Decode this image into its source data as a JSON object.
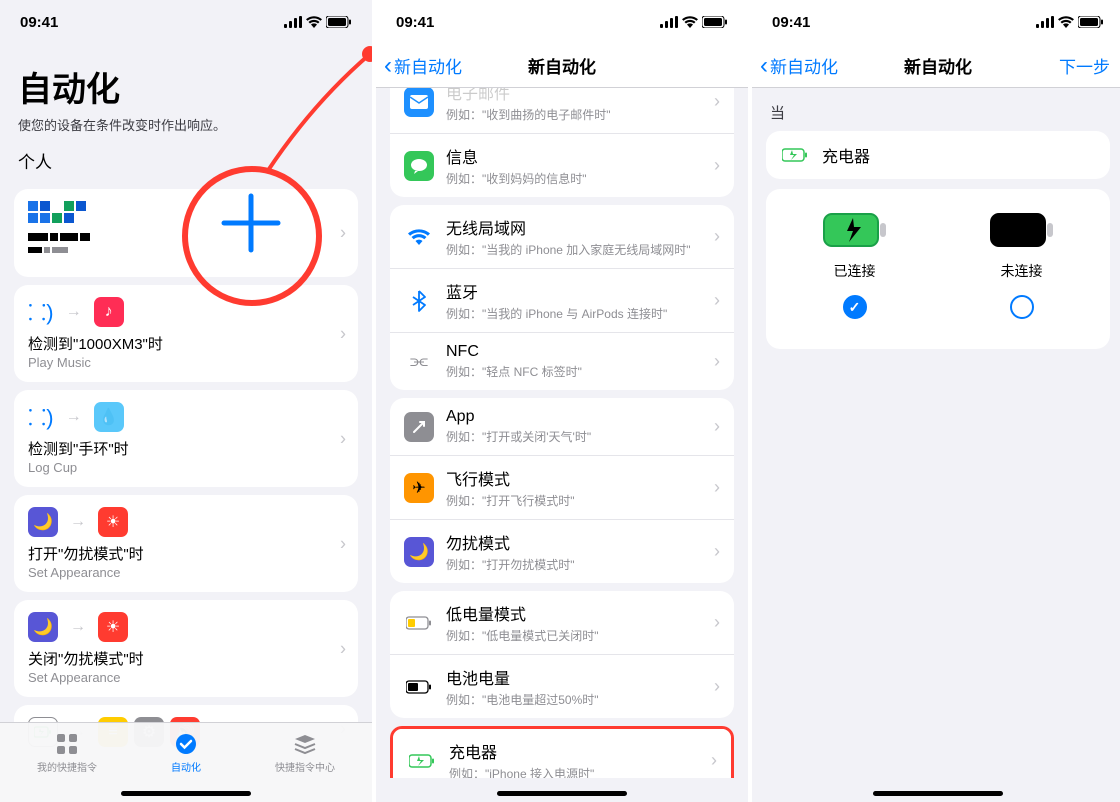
{
  "status": {
    "time": "09:41"
  },
  "screen1": {
    "large_title": "自动化",
    "subtitle": "使您的设备在条件改变时作出响应。",
    "section_personal": "个人",
    "tabs": {
      "shortcuts": "我的快捷指令",
      "automation": "自动化",
      "gallery": "快捷指令中心"
    },
    "automations": [
      {
        "title": "检测到\"1000XM3\"时",
        "sub": "Play Music"
      },
      {
        "title": "检测到\"手环\"时",
        "sub": "Log Cup"
      },
      {
        "title": "打开\"勿扰模式\"时",
        "sub": "Set Appearance"
      },
      {
        "title": "关闭\"勿扰模式\"时",
        "sub": "Set Appearance"
      }
    ]
  },
  "screen2": {
    "back": "新自动化",
    "title": "新自动化",
    "rows": [
      {
        "icon": "mail",
        "icon_label": "mail-icon",
        "title": "电子邮件",
        "desc": "例如：\"收到曲扬的电子邮件时\"",
        "color": "#1e90ff"
      },
      {
        "icon": "message",
        "icon_label": "messages-icon",
        "title": "信息",
        "desc": "例如：\"收到妈妈的信息时\"",
        "color": "#34c759"
      },
      {
        "icon": "wifi",
        "icon_label": "wifi-icon",
        "title": "无线局域网",
        "desc": "例如：\"当我的 iPhone 加入家庭无线局域网时\"",
        "color": "#007aff"
      },
      {
        "icon": "bt",
        "icon_label": "bluetooth-icon",
        "title": "蓝牙",
        "desc": "例如：\"当我的 iPhone 与 AirPods 连接时\"",
        "color": "#007aff"
      },
      {
        "icon": "nfc",
        "icon_label": "nfc-icon",
        "title": "NFC",
        "desc": "例如：\"轻点 NFC 标签时\"",
        "color": "#8e8e93"
      },
      {
        "icon": "app",
        "icon_label": "app-icon",
        "title": "App",
        "desc": "例如：\"打开或关闭'天气'时\"",
        "color": "#8e8e93"
      },
      {
        "icon": "plane",
        "icon_label": "airplane-icon",
        "title": "飞行模式",
        "desc": "例如：\"打开飞行模式时\"",
        "color": "#ff9500"
      },
      {
        "icon": "dnd",
        "icon_label": "dnd-icon",
        "title": "勿扰模式",
        "desc": "例如：\"打开勿扰模式时\"",
        "color": "#5856d6"
      },
      {
        "icon": "lowbatt",
        "icon_label": "low-power-icon",
        "title": "低电量模式",
        "desc": "例如：\"低电量模式已关闭时\"",
        "color": "#ffcc00"
      },
      {
        "icon": "battlevel",
        "icon_label": "battery-level-icon",
        "title": "电池电量",
        "desc": "例如：\"电池电量超过50%时\"",
        "color": "#8e8e93"
      },
      {
        "icon": "charger",
        "icon_label": "charger-icon",
        "title": "充电器",
        "desc": "例如：\"iPhone 接入电源时\"",
        "color": "#34c759"
      }
    ]
  },
  "screen3": {
    "back": "新自动化",
    "title": "新自动化",
    "next": "下一步",
    "when": "当",
    "condition": "充电器",
    "opt_connected": "已连接",
    "opt_disconnected": "未连接"
  }
}
